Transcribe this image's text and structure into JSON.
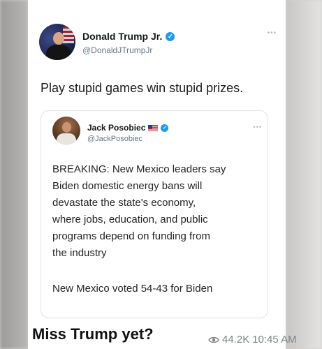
{
  "tweet": {
    "display_name": "Donald Trump Jr.",
    "handle": "@DonaldJTrumpJr",
    "verified_icon": "verified-check-icon",
    "more_icon": "ellipsis-icon",
    "text": "Play stupid games win stupid prizes."
  },
  "quoted_tweet": {
    "display_name": "Jack Posobiec",
    "flag_icon": "us-flag-icon",
    "verified_icon": "verified-check-icon",
    "handle": "@JackPosobiec",
    "more_icon": "ellipsis-icon",
    "body_lines": [
      "BREAKING: New Mexico leaders say",
      "Biden domestic energy bans will",
      "devastate the state's economy,",
      "where jobs, education, and public",
      "programs depend on funding from",
      "the industry"
    ],
    "footer": "New Mexico voted 54-43 for Biden"
  },
  "message": {
    "caption": "Miss Trump yet?",
    "views_icon": "eye-icon",
    "views": "44.2K",
    "time": "10:45 AM"
  },
  "colors": {
    "verified": "#1d9bf0",
    "handle_gray": "#687684",
    "meta_gray": "#7c8489"
  }
}
